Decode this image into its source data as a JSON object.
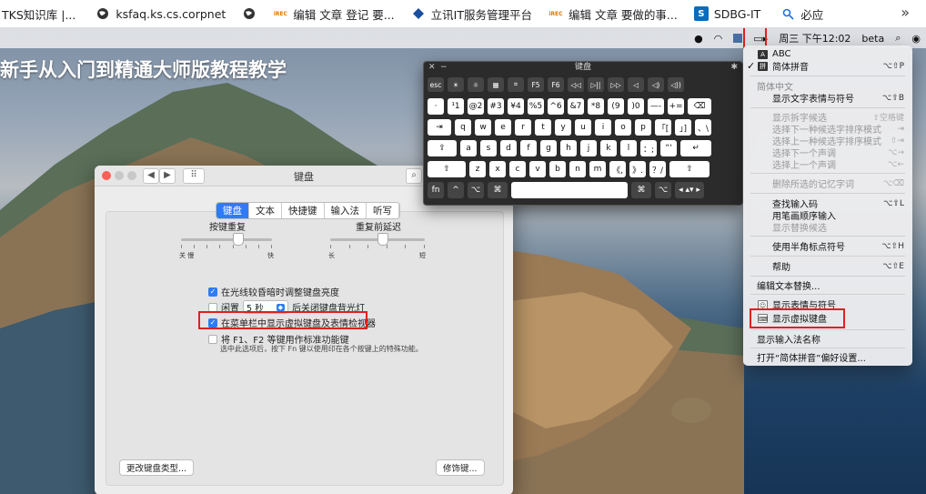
{
  "bookmarks": [
    {
      "label": "TKS知识库 |...",
      "icon": "none"
    },
    {
      "label": "ksfaq.ks.cs.corpnet",
      "icon": "globe-icon"
    },
    {
      "label": "",
      "icon": "globe-icon"
    },
    {
      "label": "编辑 文章 登记 要...",
      "icon": "rec-logo-icon"
    },
    {
      "label": "立讯IT服务管理平台",
      "icon": "diamond-icon"
    },
    {
      "label": "编辑 文章 要做的事...",
      "icon": "rec-logo-icon"
    },
    {
      "label": "SDBG-IT",
      "icon": "sharepoint-icon"
    },
    {
      "label": "必应",
      "icon": "search-icon"
    }
  ],
  "bookmarks_more": "»",
  "menubar": {
    "datetime": "周三 下午12:02",
    "user": "beta"
  },
  "hero_title": "新手从入门到精通大师版教程教学",
  "prefs": {
    "title": "键盘",
    "tabs": [
      "键盘",
      "文本",
      "快捷键",
      "输入法",
      "听写"
    ],
    "active_tab": 0,
    "key_repeat": {
      "label": "按键重复",
      "left": "关 慢",
      "right": "快",
      "level": 0.62
    },
    "repeat_delay": {
      "label": "重复前延迟",
      "left": "长",
      "right": "短",
      "level": 0.55
    },
    "opt_brightness": "在光线较昏暗时调整键盘亮度",
    "opt_idle_prefix": "闲置",
    "opt_idle_value": "5 秒",
    "opt_idle_suffix": "后关闭键盘背光灯",
    "opt_show_viewer": "在菜单栏中显示虚拟键盘及表情检视器",
    "opt_fn_keys": "将 F1、F2 等键用作标准功能键",
    "fn_hint": "选中此选项后，按下 Fn 键以使用印在各个按键上的特殊功能。",
    "btn_change_type": "更改键盘类型...",
    "btn_modifier": "修饰键..."
  },
  "vkb": {
    "title": "键盘",
    "rows": [
      [
        "esc",
        "☀",
        "☼",
        "▦",
        "⌗",
        "F5",
        "F6",
        "◁◁",
        "▷||",
        "▷▷",
        "◁",
        "◁)",
        "◁))"
      ],
      [
        "·",
        "¹1",
        "@2",
        "#3",
        "¥4",
        "%5",
        "^6",
        "&7",
        "*8",
        "(9",
        ")0",
        "—-",
        "+=",
        "⌫"
      ],
      [
        "⇥",
        "q",
        "w",
        "e",
        "r",
        "t",
        "y",
        "u",
        "i",
        "o",
        "p",
        "「[",
        "」]",
        "、\\"
      ],
      [
        "⇪",
        "a",
        "s",
        "d",
        "f",
        "g",
        "h",
        "j",
        "k",
        "l",
        "：;",
        "“'",
        "↵"
      ],
      [
        "⇧",
        "z",
        "x",
        "c",
        "v",
        "b",
        "n",
        "m",
        "《,",
        "》.",
        "？/",
        "⇧"
      ],
      [
        "fn",
        "^",
        "⌥",
        "⌘",
        "",
        "⌘",
        "⌥",
        "◂ ▴▾ ▸"
      ]
    ]
  },
  "imenu": {
    "abc": "ABC",
    "pinyin": "简体拼音",
    "pinyin_sc": "⌥⇧P",
    "hdr": "简体中文",
    "show_emoji": "显示文字表情与符号",
    "show_emoji_sc": "⌥⇧B",
    "split_cand": "显示拆字候选",
    "split_cand_sc": "⇧空格键",
    "next_mode": "选择下一种候选字排序模式",
    "next_mode_sc": "⇥",
    "prev_mode": "选择上一种候选字排序模式",
    "prev_mode_sc": "⇧⇥",
    "next_tone": "选择下一个声调",
    "next_tone_sc": "⌥→",
    "prev_tone": "选择上一个声调",
    "prev_tone_sc": "⌥←",
    "del_memo": "删除所选的记忆字词",
    "del_memo_sc": "⌥⌫",
    "lookup": "查找输入码",
    "lookup_sc": "⌥⇧L",
    "stroke": "用笔画顺序输入",
    "replace": "显示替换候选",
    "halfwidth": "使用半角标点符号",
    "halfwidth_sc": "⌥⇧H",
    "help": "帮助",
    "help_sc": "⌥⇧E",
    "edit_replace": "编辑文本替换...",
    "show_emoji2": "显示表情与符号",
    "show_vkb": "显示虚拟键盘",
    "show_name": "显示输入法名称",
    "open_prefs": "打开“简体拼音”偏好设置..."
  },
  "colors": {
    "accent": "#2f7bf5",
    "highlight": "#e02020"
  }
}
